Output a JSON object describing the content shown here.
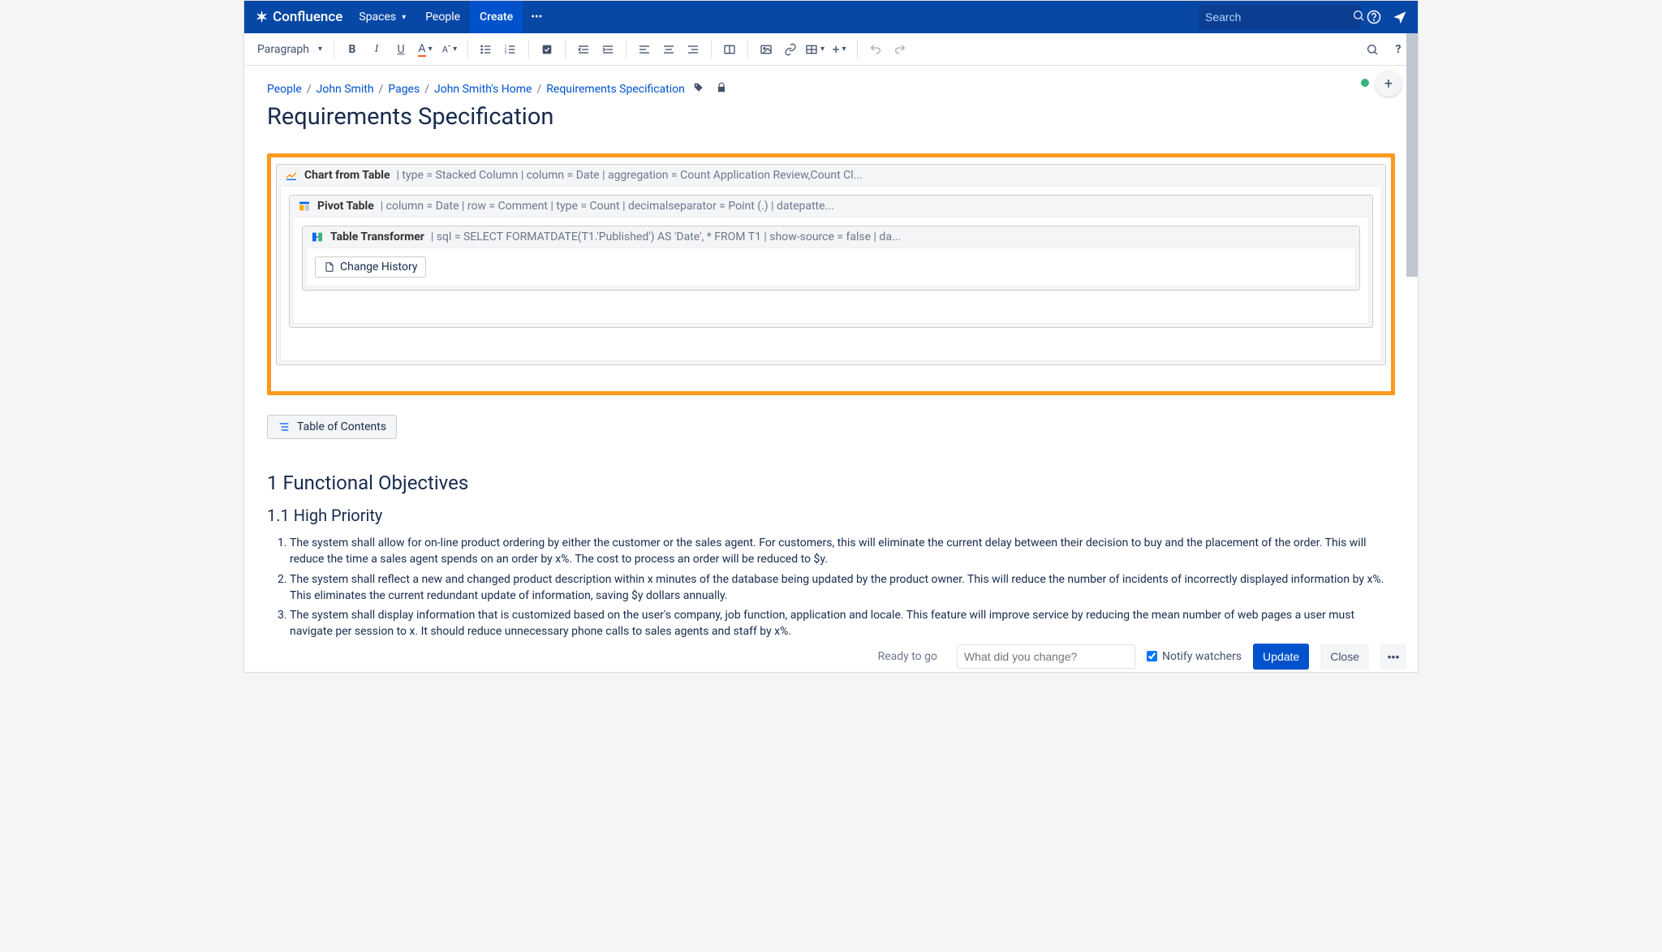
{
  "nav": {
    "app": "Confluence",
    "spaces": "Spaces",
    "people": "People",
    "create": "Create",
    "search_placeholder": "Search"
  },
  "toolbar": {
    "paragraph": "Paragraph"
  },
  "breadcrumb": {
    "items": [
      "People",
      "John Smith",
      "Pages",
      "John Smith's Home",
      "Requirements Specification"
    ]
  },
  "page": {
    "title": "Requirements Specification"
  },
  "macros": {
    "chart": {
      "name": "Chart from Table",
      "params": "| type = Stacked Column | column = Date | aggregation = Count Application Review,Count Cl..."
    },
    "pivot": {
      "name": "Pivot Table",
      "params": "| column = Date | row = Comment | type = Count | decimalseparator = Point (.) | datepatte..."
    },
    "transformer": {
      "name": "Table Transformer",
      "params": "| sql = SELECT FORMATDATE(T1.'Published') AS 'Date', * FROM T1 | show-source = false | da..."
    },
    "change_history": "Change History"
  },
  "toc": {
    "label": "Table of Contents"
  },
  "section1": {
    "title": "1 Functional Objectives",
    "sub_title": "1.1 High Priority",
    "items": [
      "The system shall allow for on-line product ordering by either the customer or the sales agent. For customers, this will eliminate the current delay between their decision to buy and the placement of the order. This will reduce the time a sales agent spends on an order by x%. The cost to process an order will be reduced to $y.",
      "The system shall reflect a new and changed product description within x minutes of the database being updated by the product owner. This will reduce the number of incidents of incorrectly displayed information by x%. This eliminates the current redundant update of information, saving $y dollars annually.",
      "The system shall display information that is customized based on the user's company, job function, application and locale. This feature will improve service by reducing the mean number of web pages a user must navigate per session to x. It should reduce unnecessary phone calls to sales agents and staff by x%."
    ]
  },
  "footer": {
    "ready": "Ready to go",
    "change_placeholder": "What did you change?",
    "notify": "Notify watchers",
    "update": "Update",
    "close": "Close"
  }
}
